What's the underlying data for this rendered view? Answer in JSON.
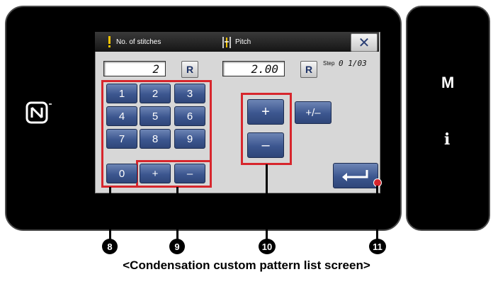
{
  "dialog": {
    "field1_label": "No. of stitches",
    "field2_label": "Pitch",
    "close_symbol": "✕",
    "stitches_value": "2",
    "pitch_value": "2.00",
    "reset_label": "R",
    "step_label": "Step",
    "step_value": "0 1/03"
  },
  "keypad": {
    "keys": [
      "1",
      "2",
      "3",
      "4",
      "5",
      "6",
      "7",
      "8",
      "9",
      "0",
      "+",
      "–"
    ]
  },
  "pitch_controls": {
    "plus": "+",
    "plusminus": "+/–",
    "minus": "–"
  },
  "side_panel": {
    "m_label": "M",
    "info_label": "i"
  },
  "callouts": [
    "8",
    "9",
    "10",
    "11"
  ],
  "caption": "<Condensation custom pattern list screen>",
  "colors": {
    "highlight": "#d7262d",
    "key_blue": "#3c568f"
  },
  "icons": [
    "pin-icon",
    "pitch-icon",
    "close-icon",
    "enter-icon",
    "nfc-icon"
  ]
}
